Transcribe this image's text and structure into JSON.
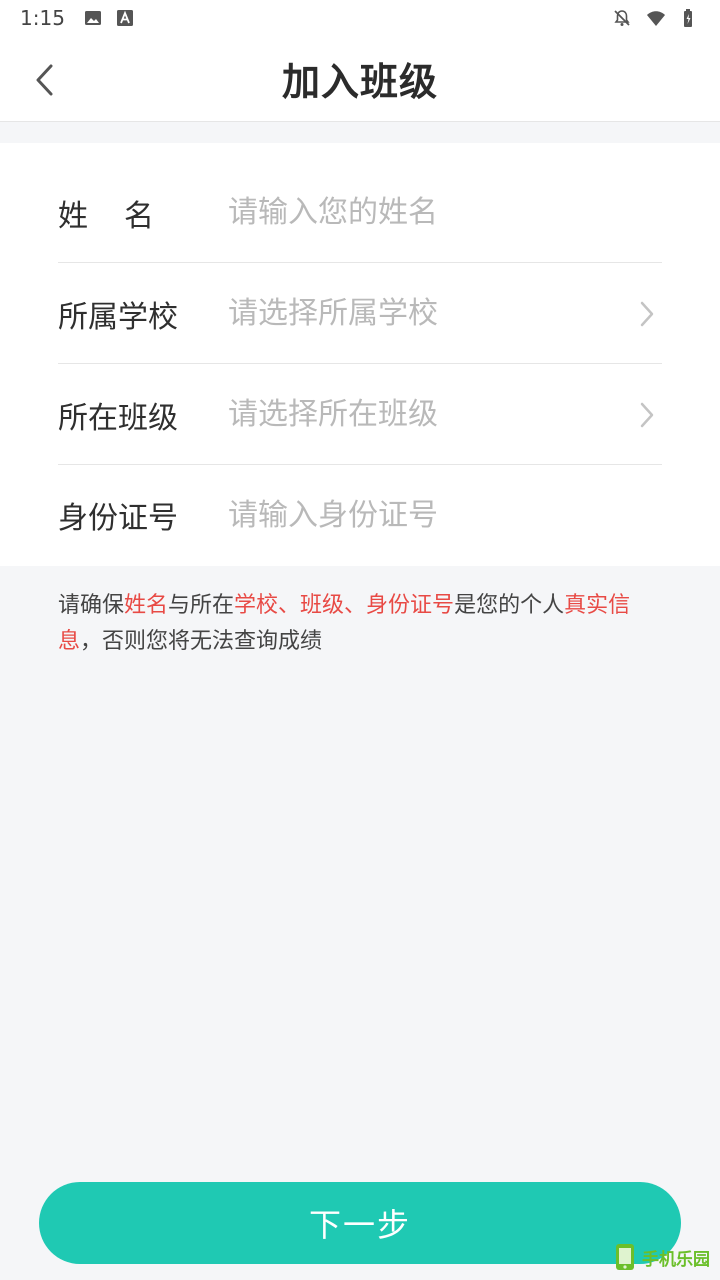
{
  "status_bar": {
    "time": "1:15",
    "left_icons": [
      "image-icon",
      "font-a-icon"
    ],
    "right_icons": [
      "mute-icon",
      "wifi-icon",
      "battery-icon"
    ]
  },
  "header": {
    "title": "加入班级",
    "back_icon": "chevron-left-icon"
  },
  "form": {
    "name": {
      "label": "姓名",
      "placeholder": "请输入您的姓名"
    },
    "school": {
      "label": "所属学校",
      "placeholder": "请选择所属学校"
    },
    "class": {
      "label": "所在班级",
      "placeholder": "请选择所在班级"
    },
    "id_number": {
      "label": "身份证号",
      "placeholder": "请输入身份证号"
    }
  },
  "notice": {
    "p1": "请确保",
    "h1": "姓名",
    "p2": "与所在",
    "h2": "学校、班级、身份证号",
    "p3": "是您的个人",
    "h3": "真实信息",
    "p4": "，否则您将无法查询成绩"
  },
  "colors": {
    "accent": "#1fc9b3",
    "highlight": "#e84a45",
    "background": "#f5f6f8"
  },
  "next_button": {
    "label": "下一步"
  },
  "watermark": {
    "text": "手机乐园"
  }
}
